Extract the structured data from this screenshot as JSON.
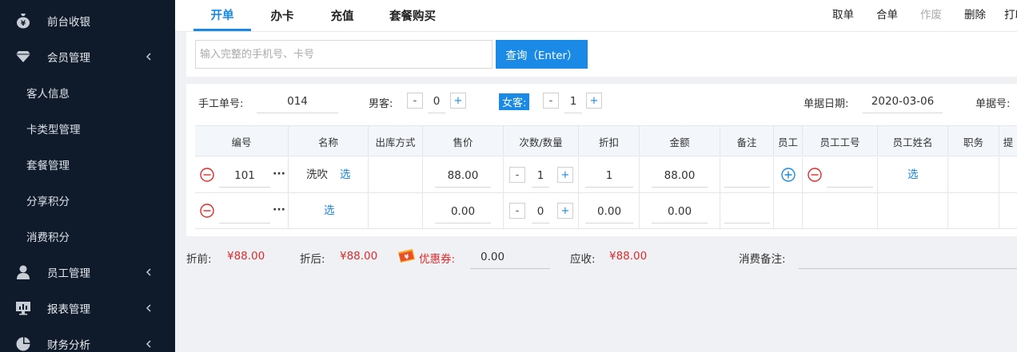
{
  "sidebar": {
    "items": [
      {
        "label": "前台收银",
        "icon": "money-bag-icon",
        "expandable": false
      },
      {
        "label": "会员管理",
        "icon": "diamond-icon",
        "expandable": true
      },
      {
        "label": "员工管理",
        "icon": "person-icon",
        "expandable": true
      },
      {
        "label": "报表管理",
        "icon": "monitor-chart-icon",
        "expandable": true
      },
      {
        "label": "财务分析",
        "icon": "pie-chart-icon",
        "expandable": true
      }
    ],
    "sub_items": [
      "客人信息",
      "卡类型管理",
      "套餐管理",
      "分享积分",
      "消费积分"
    ]
  },
  "tabs": [
    "开单",
    "办卡",
    "充值",
    "套餐购买"
  ],
  "active_tab": "开单",
  "actions": [
    "取单",
    "合单",
    "作废",
    "删除",
    "打印"
  ],
  "search": {
    "placeholder": "输入完整的手机号、卡号",
    "value": "",
    "button": "查询（Enter）"
  },
  "form": {
    "manual_no_label": "手工单号:",
    "manual_no": "014",
    "male_label": "男客:",
    "male_count": "0",
    "female_label": "女客:",
    "female_count": "1",
    "date_label": "单据日期:",
    "date": "2020-03-06",
    "bill_no_label": "单据号:",
    "minus": "-",
    "plus": "+"
  },
  "table": {
    "headers": [
      "编号",
      "名称",
      "出库方式",
      "售价",
      "次数/数量",
      "折扣",
      "金额",
      "备注",
      "员工",
      "员工工号",
      "员工姓名",
      "职务",
      "提"
    ],
    "rows": [
      {
        "code": "101",
        "name": "洗吹",
        "select": "选",
        "price": "88.00",
        "qty": "1",
        "discount": "1",
        "amount": "88.00",
        "staff_select": "选",
        "has_staff_row": true
      },
      {
        "code": "",
        "name": "",
        "select": "选",
        "price": "0.00",
        "qty": "0",
        "discount": "0.00",
        "amount": "0.00",
        "staff_select": "",
        "has_staff_row": false
      }
    ],
    "dots": "···"
  },
  "summary": {
    "before_label": "折前:",
    "before": "¥88.00",
    "after_label": "折后:",
    "after": "¥88.00",
    "coupon_label": "优惠券:",
    "coupon_value": "0.00",
    "due_label": "应收:",
    "due": "¥88.00",
    "note_label": "消费备注:",
    "note_value": ""
  },
  "colors": {
    "accent": "#1a8ae6",
    "sidebar_bg": "#0f1b2b",
    "money": "#e02a2a",
    "remove": "#e02a2a"
  }
}
